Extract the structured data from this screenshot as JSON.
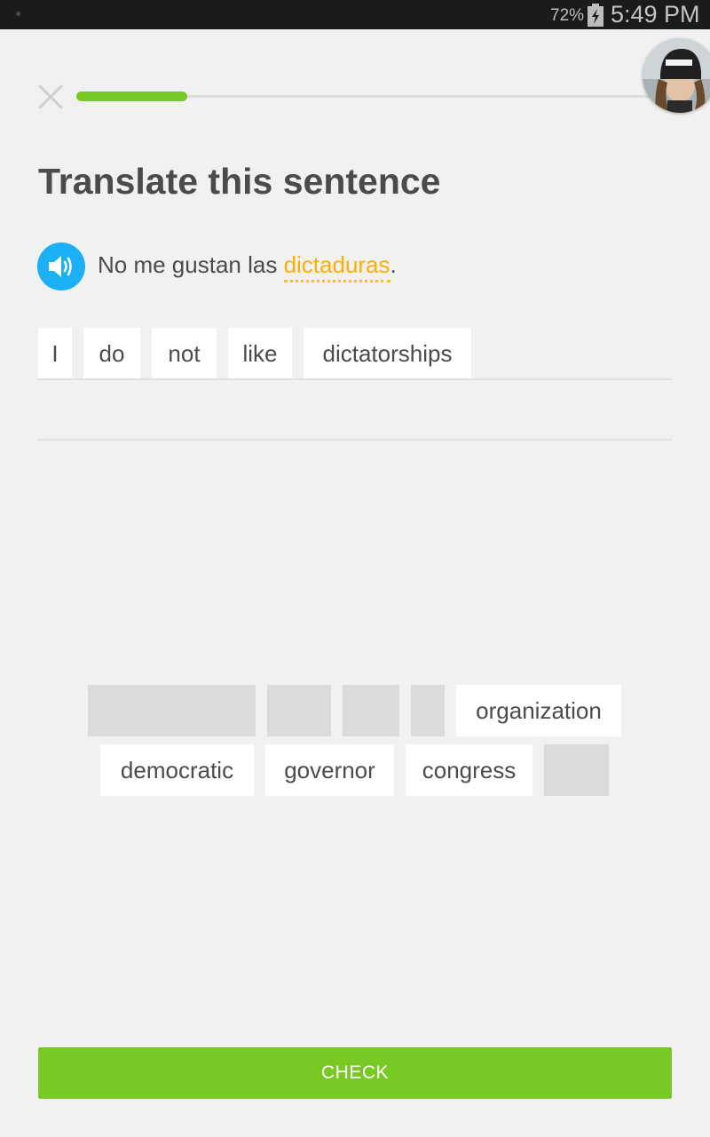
{
  "status_bar": {
    "battery_percent": "72%",
    "time": "5:49 PM"
  },
  "lesson": {
    "progress_fraction": 0.19,
    "close_icon": "close-icon",
    "avatar_icon": "user-avatar"
  },
  "prompt": {
    "title": "Translate this sentence",
    "speaker_icon": "speaker-icon",
    "sentence_before": "No me gustan las ",
    "sentence_hint_word": "dictaduras",
    "sentence_after": "."
  },
  "answer": {
    "selected_words": [
      "I",
      "do",
      "not",
      "like",
      "dictatorships"
    ]
  },
  "word_bank": {
    "row1_available": [
      "organization"
    ],
    "row2_available": [
      "democratic",
      "governor",
      "congress"
    ]
  },
  "check_button": {
    "label": "CHECK"
  },
  "colors": {
    "accent_green": "#78c924",
    "speaker_blue": "#1cb0f6",
    "hint_orange": "#ffaf02",
    "title_text": "#4b4b4b"
  }
}
